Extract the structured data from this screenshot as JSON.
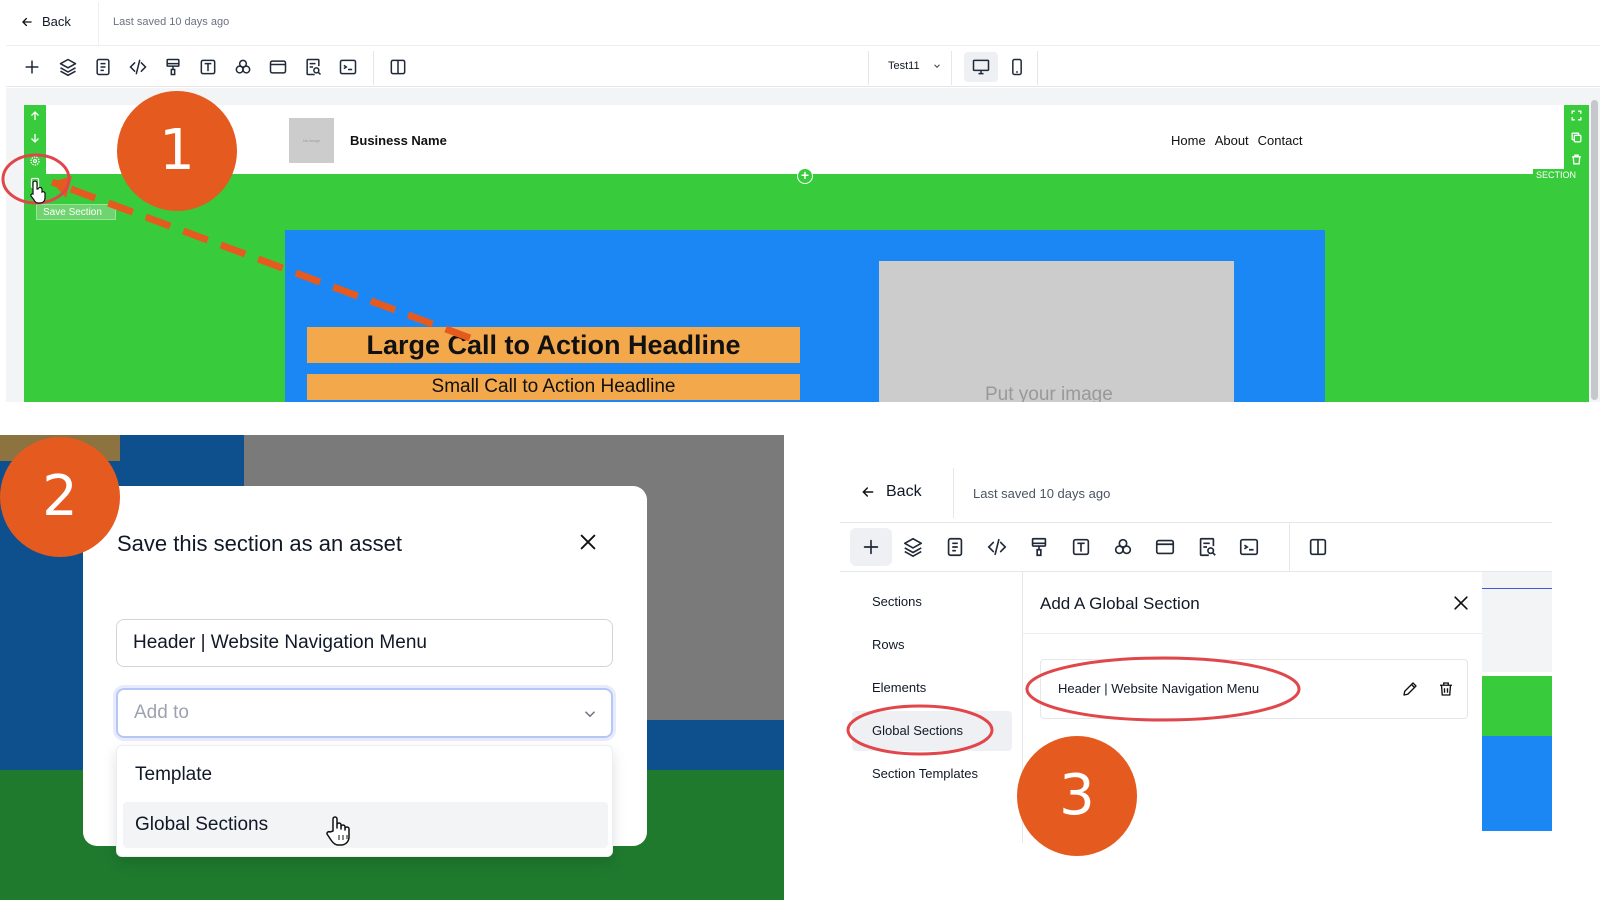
{
  "panel1": {
    "back_label": "Back",
    "saved_text": "Last saved 10 days ago",
    "toolbar_icons": [
      "plus-icon",
      "layers-icon",
      "page-icon",
      "code-icon",
      "paint-icon",
      "text-icon",
      "shapes-icon",
      "browser-icon",
      "search-doc-icon",
      "terminal-icon",
      "split-view-icon"
    ],
    "page_select": "Test11",
    "canvas": {
      "logo_text": "No image",
      "business_name": "Business Name",
      "nav": [
        "Home",
        "About",
        "Contact"
      ],
      "section_tag": "SECTION",
      "tooltip": "Save Section",
      "cta_large": "Large Call to Action Headline",
      "cta_small": "Small Call to Action Headline",
      "image_placeholder": "Put your image"
    }
  },
  "panel2": {
    "modal_title": "Save this section as an asset",
    "name_value": "Header | Website Navigation Menu",
    "add_to_placeholder": "Add to",
    "options": [
      "Template",
      "Global Sections"
    ]
  },
  "panel3": {
    "back_label": "Back",
    "saved_text": "Last saved 10 days ago",
    "nav_items": [
      "Sections",
      "Rows",
      "Elements",
      "Global Sections",
      "Section Templates"
    ],
    "panel_title": "Add A Global Section",
    "card_label": "Header | Website Navigation Menu"
  },
  "annotations": {
    "step1": "1",
    "step2": "2",
    "step3": "3",
    "accent_color": "#e55a1f",
    "highlight_color": "#e0464a"
  },
  "colors": {
    "section_green": "#38cc3c",
    "row_blue": "#1b87f5",
    "cta_orange": "#f3a84c"
  }
}
